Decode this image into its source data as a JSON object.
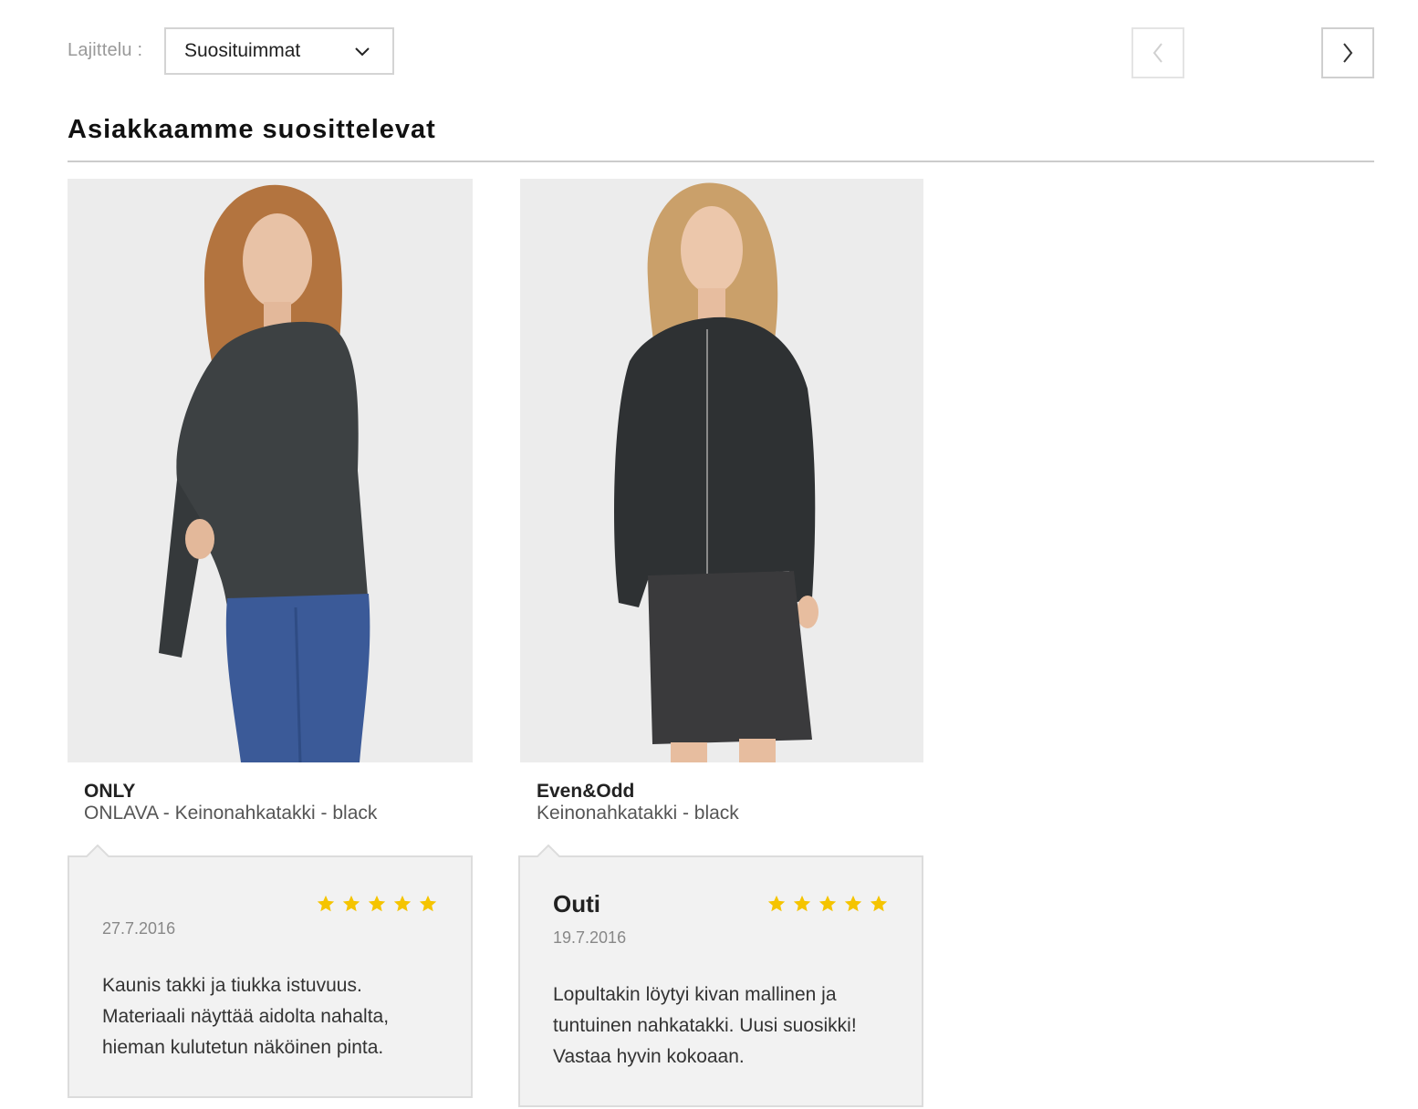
{
  "sort": {
    "label": "Lajittelu :",
    "selected": "Suosituimmat"
  },
  "pager": {
    "prev_icon": "chevron-left-icon",
    "next_icon": "chevron-right-icon"
  },
  "section": {
    "title": "Asiakkaamme suosittelevat"
  },
  "products": [
    {
      "brand": "ONLY",
      "name": "ONLAVA - Keinonahkatakki - black",
      "review": {
        "reviewer": "",
        "rating": 5,
        "date": "27.7.2016",
        "text": "Kaunis takki ja tiukka istuvuus. Materiaali näyttää aidolta nahalta, hieman kulutetun näköinen pinta."
      }
    },
    {
      "brand": "Even&Odd",
      "name": "Keinonahkatakki - black",
      "review": {
        "reviewer": "Outi",
        "rating": 5,
        "date": "19.7.2016",
        "text": "Lopultakin löytyi kivan mallinen ja tuntuinen nahkatakki. Uusi suosikki! Vastaa hyvin kokoaan."
      }
    }
  ],
  "colors": {
    "star": "#f5c400",
    "review_bg": "#f2f2f2",
    "border": "#d4d4d4"
  }
}
